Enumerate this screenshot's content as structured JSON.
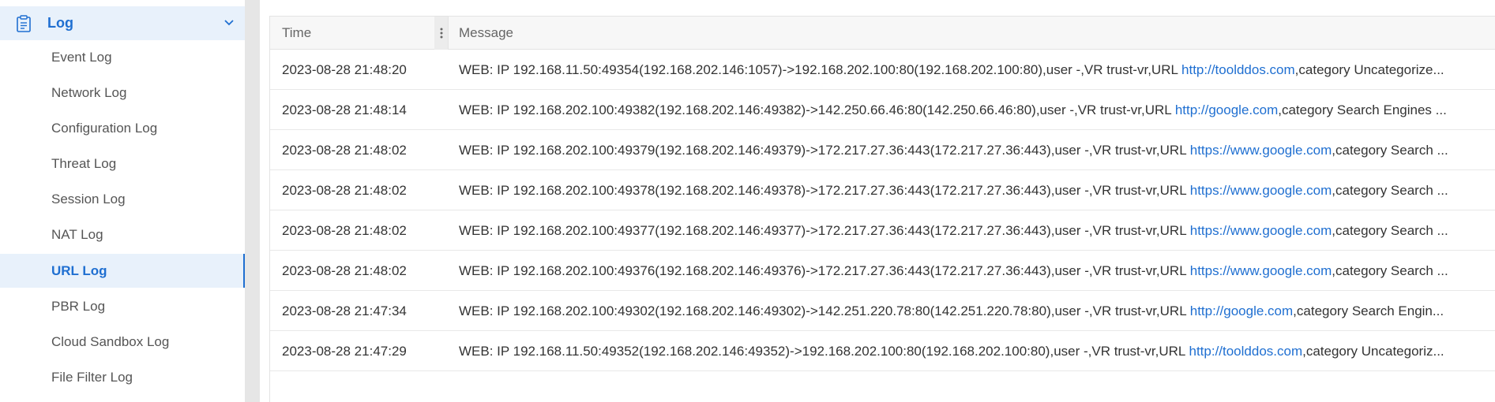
{
  "sidebar": {
    "header": {
      "label": "Log",
      "icon": "clipboard-icon",
      "expand_icon": "chevron-down-icon"
    },
    "accent_color": "#1f6fd1",
    "items": [
      {
        "label": "Event Log"
      },
      {
        "label": "Network Log"
      },
      {
        "label": "Configuration Log"
      },
      {
        "label": "Threat Log"
      },
      {
        "label": "Session Log"
      },
      {
        "label": "NAT Log"
      },
      {
        "label": "URL Log",
        "active": true
      },
      {
        "label": "PBR Log"
      },
      {
        "label": "Cloud Sandbox Log"
      },
      {
        "label": "File Filter Log"
      }
    ]
  },
  "table": {
    "columns": {
      "time": "Time",
      "message": "Message"
    },
    "rows": [
      {
        "time": "2023-08-28 21:48:20",
        "pre": "WEB: IP 192.168.11.50:49354(192.168.202.146:1057)->192.168.202.100:80(192.168.202.100:80),user -,VR trust-vr,URL ",
        "url": "http://toolddos.com",
        "post": ",category Uncategorize..."
      },
      {
        "time": "2023-08-28 21:48:14",
        "pre": "WEB: IP 192.168.202.100:49382(192.168.202.146:49382)->142.250.66.46:80(142.250.66.46:80),user -,VR trust-vr,URL ",
        "url": "http://google.com",
        "post": ",category Search Engines ..."
      },
      {
        "time": "2023-08-28 21:48:02",
        "pre": "WEB: IP 192.168.202.100:49379(192.168.202.146:49379)->172.217.27.36:443(172.217.27.36:443),user -,VR trust-vr,URL ",
        "url": "https://www.google.com",
        "post": ",category Search ..."
      },
      {
        "time": "2023-08-28 21:48:02",
        "pre": "WEB: IP 192.168.202.100:49378(192.168.202.146:49378)->172.217.27.36:443(172.217.27.36:443),user -,VR trust-vr,URL ",
        "url": "https://www.google.com",
        "post": ",category Search ..."
      },
      {
        "time": "2023-08-28 21:48:02",
        "pre": "WEB: IP 192.168.202.100:49377(192.168.202.146:49377)->172.217.27.36:443(172.217.27.36:443),user -,VR trust-vr,URL ",
        "url": "https://www.google.com",
        "post": ",category Search ..."
      },
      {
        "time": "2023-08-28 21:48:02",
        "pre": "WEB: IP 192.168.202.100:49376(192.168.202.146:49376)->172.217.27.36:443(172.217.27.36:443),user -,VR trust-vr,URL ",
        "url": "https://www.google.com",
        "post": ",category Search ..."
      },
      {
        "time": "2023-08-28 21:47:34",
        "pre": "WEB: IP 192.168.202.100:49302(192.168.202.146:49302)->142.251.220.78:80(142.251.220.78:80),user -,VR trust-vr,URL ",
        "url": "http://google.com",
        "post": ",category Search Engin..."
      },
      {
        "time": "2023-08-28 21:47:29",
        "pre": "WEB: IP 192.168.11.50:49352(192.168.202.146:49352)->192.168.202.100:80(192.168.202.100:80),user -,VR trust-vr,URL ",
        "url": "http://toolddos.com",
        "post": ",category Uncategoriz..."
      }
    ]
  }
}
